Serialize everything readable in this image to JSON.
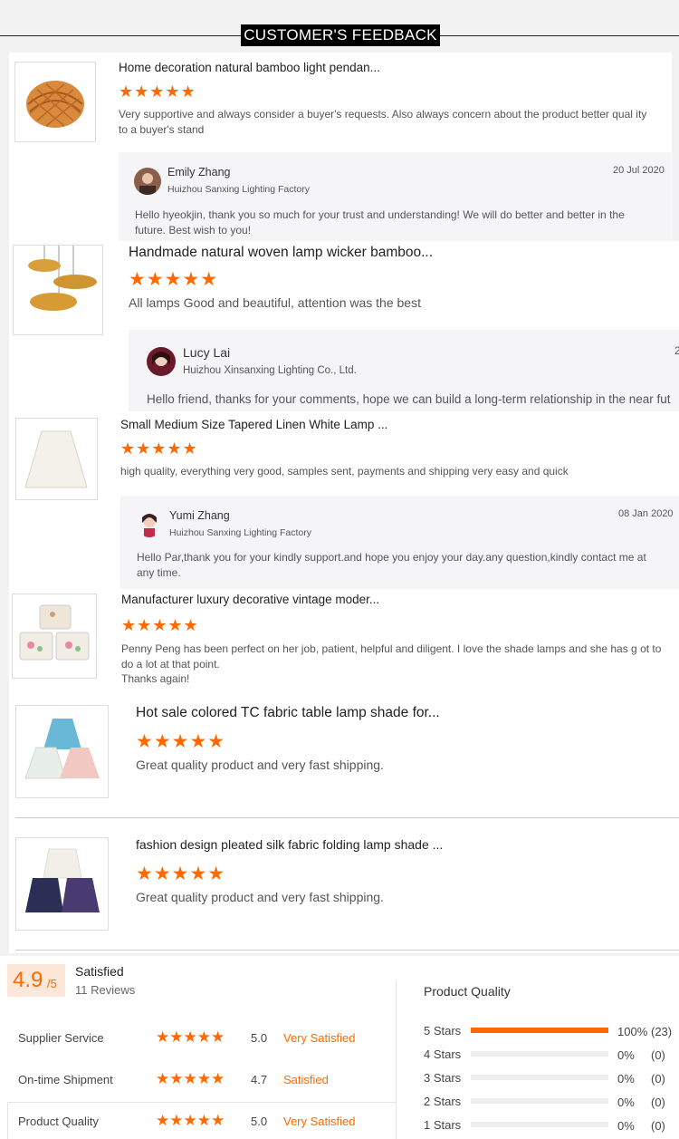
{
  "header": {
    "title": "CUSTOMER'S FEEDBACK"
  },
  "reviews": [
    {
      "product": "Home decoration natural bamboo light pendan...",
      "stars": "★★★★★",
      "text": "Very supportive and always consider a buyer's requests. Also always concern about the product better qual ity to a buyer's stand",
      "reply": {
        "name": "Emily Zhang",
        "company": "Huizhou Sanxing Lighting Factory",
        "date": "20 Jul 2020",
        "message": "Hello hyeokjin, thank you so much for your trust and understanding!  We will do better and better in the future. Best wish to you!"
      }
    },
    {
      "product": "Handmade natural woven lamp wicker bamboo...",
      "stars": "★★★★★",
      "text": "All lamps Good and beautiful, attention was the best",
      "reply": {
        "name": "Lucy Lai",
        "company": "Huizhou Xinsanxing Lighting Co., Ltd.",
        "date": "2",
        "message": "Hello friend, thanks for your comments, hope we can build a long-term relationship in the near fut"
      }
    },
    {
      "product": "Small Medium Size Tapered Linen White Lamp ...",
      "stars": "★★★★★",
      "text": "high quality,  everything very good, samples sent, payments and shipping very easy and quick",
      "reply": {
        "name": "Yumi Zhang",
        "company": "Huizhou Sanxing Lighting Factory",
        "date": "08 Jan 2020",
        "message": "Hello Par,thank you for your kindly support.and hope you enjoy your day.any question,kindly contact me at any time."
      }
    },
    {
      "product": "Manufacturer luxury decorative vintage moder...",
      "stars": "★★★★★",
      "text": "Penny Peng has been perfect on her job, patient, helpful and diligent. I love the shade lamps and she has g ot to do a lot at that point.",
      "text2": "Thanks again!"
    },
    {
      "product": "Hot sale colored TC fabric table lamp shade for...",
      "stars": "★★★★★",
      "text": "Great quality product and very fast shipping."
    },
    {
      "product": "fashion design pleated silk fabric folding lamp shade ...",
      "stars": "★★★★★",
      "text": "Great quality product and very fast shipping."
    }
  ],
  "summary": {
    "score": "4.9",
    "out_of": "/5",
    "label": "Satisfied",
    "reviews": "11 Reviews",
    "metrics": [
      {
        "label": "Supplier Service",
        "stars": "★★★★★",
        "value": "5.0",
        "status": "Very Satisfied"
      },
      {
        "label": "On-time Shipment",
        "stars": "★★★★★",
        "value": "4.7",
        "status": "Satisfied"
      },
      {
        "label": "Product Quality",
        "stars": "★★★★★",
        "value": "5.0",
        "status": "Very Satisfied"
      }
    ],
    "breakdown_title": "Product Quality",
    "breakdown": [
      {
        "label": "5 Stars",
        "pct": "100%",
        "count": "(23)",
        "fraction": 1.0
      },
      {
        "label": "4 Stars",
        "pct": "0%",
        "count": "(0)",
        "fraction": 0
      },
      {
        "label": "3 Stars",
        "pct": "0%",
        "count": "(0)",
        "fraction": 0
      },
      {
        "label": "2 Stars",
        "pct": "0%",
        "count": "(0)",
        "fraction": 0
      },
      {
        "label": "1 Stars",
        "pct": "0%",
        "count": "(0)",
        "fraction": 0
      }
    ]
  },
  "colors": {
    "accent": "#ff6a00",
    "header_bg": "#000000"
  }
}
